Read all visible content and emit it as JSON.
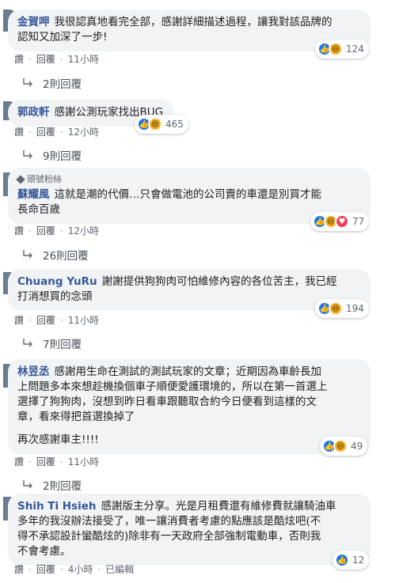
{
  "comments": [
    {
      "name": "金賀呷",
      "lines": [
        "我很認真地看完全部，感謝詳細描述過程，讓我對該品牌的",
        "認知又加深了一步!"
      ],
      "reaction_count": "124",
      "actions": {
        "like": "讚",
        "reply": "回覆",
        "time": "11小時"
      },
      "replies_label": "2則回覆"
    },
    {
      "name": "郭政軒",
      "lines": [
        "感謝公測玩家找出BUG"
      ],
      "reaction_count": "465",
      "actions": {
        "like": "讚",
        "reply": "回覆",
        "time": "12小時"
      },
      "replies_label": "9則回覆"
    },
    {
      "badge": "頭號粉絲",
      "name": "蘇耀風",
      "lines": [
        "這就是潮的代價…只會做電池的公司賣的車還是別買才能",
        "長命百歲"
      ],
      "reaction_count": "77",
      "actions": {
        "like": "讚",
        "reply": "回覆",
        "time": "12小時"
      },
      "replies_label": "26則回覆"
    },
    {
      "name": "Chuang YuRu",
      "lines": [
        "謝謝提供狗狗肉可怕維修內容的各位苦主，我已經",
        "打消想買的念頭"
      ],
      "reaction_count": "194",
      "actions": {
        "like": "讚",
        "reply": "回覆",
        "time": "11小時"
      },
      "replies_label": "7則回覆"
    },
    {
      "name": "林昱丞",
      "lines": [
        "感謝用生命在測試的測試玩家的文章；近期因為車齡長加",
        "上問題多本來想趁機換個車子順便愛護環境的，所以在第一首選上",
        "選擇了狗狗肉，沒想到昨日看車跟聽取合約今日便看到這樣的文",
        "章，看來得把首選換掉了",
        "",
        "再次感謝車主!!!!"
      ],
      "reaction_count": "49",
      "actions": {
        "like": "讚",
        "reply": "回覆",
        "time": "11小時"
      },
      "replies_label": "2則回覆"
    },
    {
      "name": "Shih Ti Hsieh",
      "lines": [
        "感謝版主分享。光是月租費還有維修費就讓騎油車",
        "多年的我沒辦法接受了，唯一讓消費者考慮的點應該是酷炫吧(不",
        "得不承認設計蠻酷炫的)除非有一天政府全部強制電動車，否則我",
        "不會考慮。"
      ],
      "reaction_count": "12",
      "actions": {
        "like": "讚",
        "reply": "回覆",
        "time": "4小時",
        "edited": "已編輯"
      }
    }
  ]
}
